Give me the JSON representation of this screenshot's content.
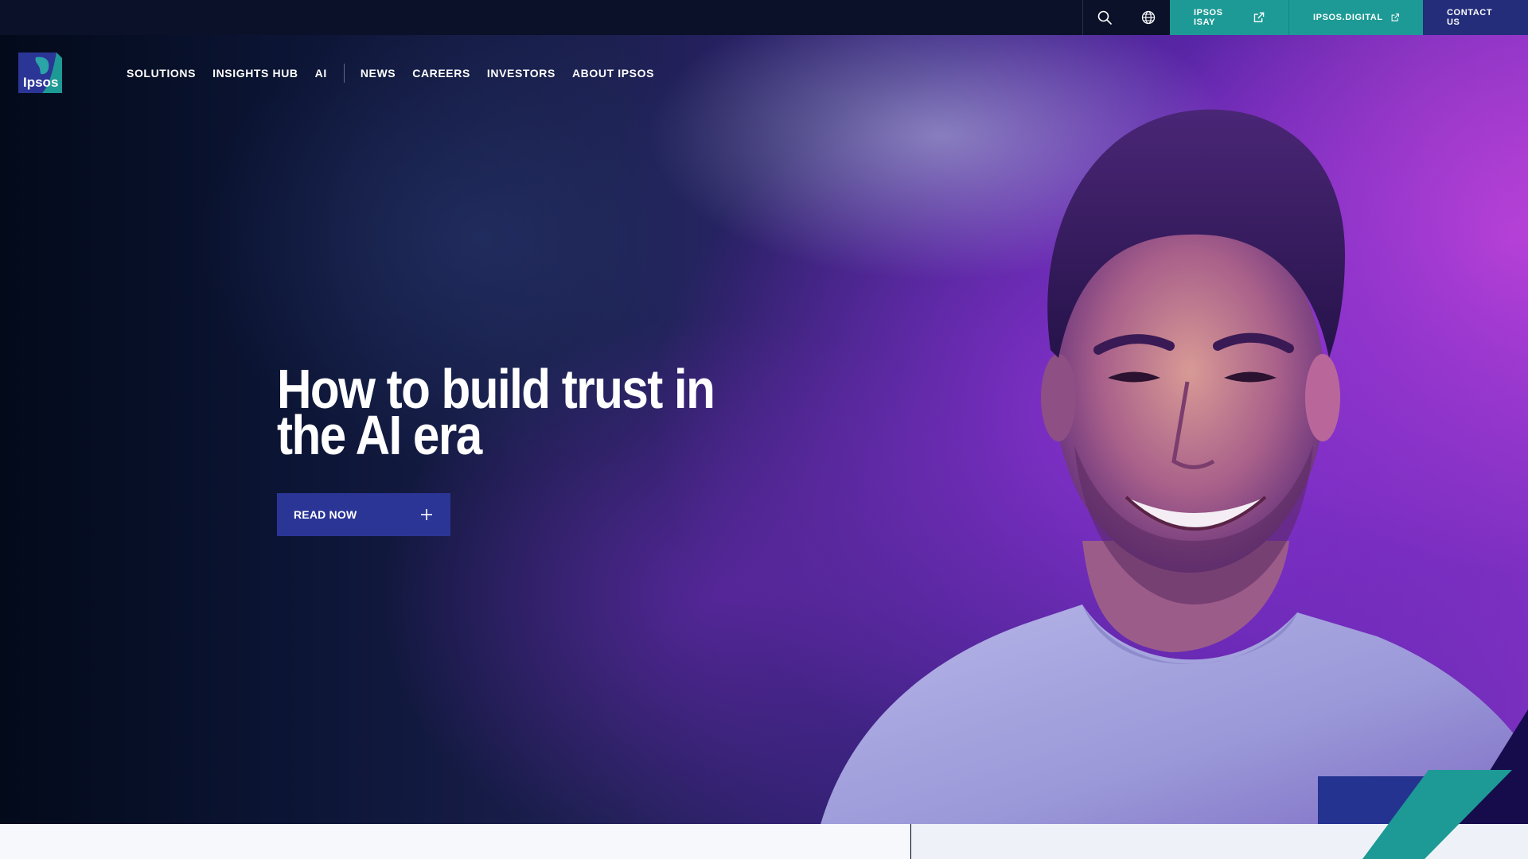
{
  "topbar": {
    "search_icon": "search-icon",
    "globe_icon": "globe-icon",
    "links": [
      {
        "label": "IPSOS ISAY",
        "icon": "external-link-icon"
      },
      {
        "label": "IPSOS.DIGITAL",
        "icon": "external-link-icon"
      }
    ],
    "contact_label": "CONTACT US"
  },
  "logo": {
    "text": "Ipsos"
  },
  "nav": {
    "primary": [
      "SOLUTIONS",
      "INSIGHTS HUB",
      "AI"
    ],
    "secondary": [
      "NEWS",
      "CAREERS",
      "INVESTORS",
      "ABOUT IPSOS"
    ]
  },
  "hero": {
    "headline_line1": "How to build trust in",
    "headline_line2": "the AI era",
    "cta_label": "READ NOW",
    "cta_icon": "plus-icon"
  },
  "colors": {
    "teal": "#1d9a95",
    "navy": "#232d7a",
    "cta": "#2b3596",
    "topbar": "#0a1128"
  }
}
